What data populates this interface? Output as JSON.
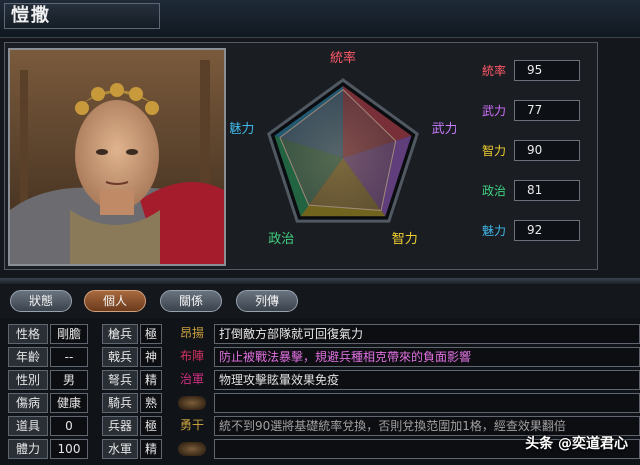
{
  "officer": {
    "name": "愷撒"
  },
  "radar": {
    "labels": [
      "統率",
      "武力",
      "智力",
      "政治",
      "魅力"
    ],
    "label_colors": [
      "#ff5a6a",
      "#c87cff",
      "#f0d030",
      "#40d080",
      "#40b8e8"
    ],
    "max": 100,
    "values": [
      95,
      77,
      90,
      81,
      92
    ]
  },
  "stats": [
    {
      "label": "統率",
      "value": "95",
      "color": "#ff5a6a"
    },
    {
      "label": "武力",
      "value": "77",
      "color": "#d070ff"
    },
    {
      "label": "智力",
      "value": "90",
      "color": "#f0d030"
    },
    {
      "label": "政治",
      "value": "81",
      "color": "#40d080"
    },
    {
      "label": "魅力",
      "value": "92",
      "color": "#40b8e8"
    }
  ],
  "tabs": [
    "狀態",
    "個人",
    "關係",
    "列傳"
  ],
  "active_tab": 1,
  "info": [
    {
      "label": "性格",
      "value": "剛膽"
    },
    {
      "label": "年齡",
      "value": "--"
    },
    {
      "label": "性別",
      "value": "男"
    },
    {
      "label": "傷病",
      "value": "健康"
    },
    {
      "label": "道具",
      "value": "0"
    },
    {
      "label": "體力",
      "value": "100"
    }
  ],
  "aptitude": [
    {
      "label": "槍兵",
      "value": "極"
    },
    {
      "label": "戟兵",
      "value": "神"
    },
    {
      "label": "弩兵",
      "value": "精"
    },
    {
      "label": "騎兵",
      "value": "熟"
    },
    {
      "label": "兵器",
      "value": "極"
    },
    {
      "label": "水軍",
      "value": "精"
    }
  ],
  "skills": [
    {
      "name": "昂揚",
      "name_color": "#c8a040",
      "desc": "打倒敵方部隊就可回復氣力",
      "desc_color": "#e8e8e8"
    },
    {
      "name": "布陣",
      "name_color": "#d03060",
      "desc": "防止被戰法暴擊，規避兵種相克帶來的負面影響",
      "desc_color": "#e070e0"
    },
    {
      "name": "治軍",
      "name_color": "#d03080",
      "desc": "物理攻擊眩暈效果免疫",
      "desc_color": "#e0e0e0"
    },
    {
      "name": "",
      "name_color": "#888",
      "desc": "",
      "desc_color": "#e0e0e0"
    },
    {
      "name": "勇干",
      "name_color": "#c8a040",
      "desc": "統不到90選將基礎統率兌換，否則兌換范圍加1格，經查效果翻倍",
      "desc_color": "#a0a0a0"
    },
    {
      "name": "",
      "name_color": "#888",
      "desc": "",
      "desc_color": "#e0e0e0"
    }
  ],
  "watermark": "头条 @奕道君心"
}
